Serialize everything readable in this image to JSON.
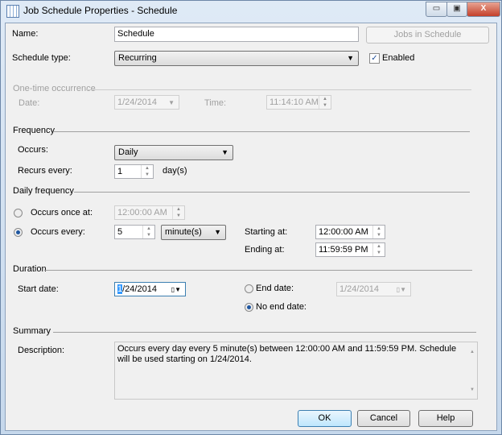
{
  "window": {
    "title": "Job Schedule Properties - Schedule",
    "minimize": "▭",
    "maximize": "▣",
    "close": "X"
  },
  "name": {
    "label": "Name:",
    "value": "Schedule"
  },
  "jobs_button": "Jobs in Schedule",
  "schedule_type": {
    "label": "Schedule type:",
    "value": "Recurring"
  },
  "enabled": {
    "label": "Enabled",
    "checked": true
  },
  "one_time": {
    "section": "One-time occurrence",
    "date_label": "Date:",
    "date": "1/24/2014",
    "time_label": "Time:",
    "time": "11:14:10 AM"
  },
  "frequency": {
    "section": "Frequency",
    "occurs_label": "Occurs:",
    "occurs": "Daily",
    "recurs_label": "Recurs every:",
    "recurs": "1",
    "recurs_unit": "day(s)"
  },
  "daily": {
    "section": "Daily frequency",
    "once_label": "Occurs once at:",
    "once_time": "12:00:00 AM",
    "every_label": "Occurs every:",
    "every_value": "5",
    "every_unit": "minute(s)",
    "start_label": "Starting at:",
    "start": "12:00:00 AM",
    "end_label": "Ending at:",
    "end": "11:59:59 PM"
  },
  "duration": {
    "section": "Duration",
    "start_label": "Start date:",
    "start_sel": "1",
    "start_rest": "/24/2014",
    "end_label": "End date:",
    "end": "1/24/2014",
    "noend_label": "No end date:"
  },
  "summary": {
    "section": "Summary",
    "desc_label": "Description:",
    "description": "Occurs every day every 5 minute(s) between 12:00:00 AM and 11:59:59 PM. Schedule will be used starting on 1/24/2014."
  },
  "buttons": {
    "ok": "OK",
    "cancel": "Cancel",
    "help": "Help"
  }
}
